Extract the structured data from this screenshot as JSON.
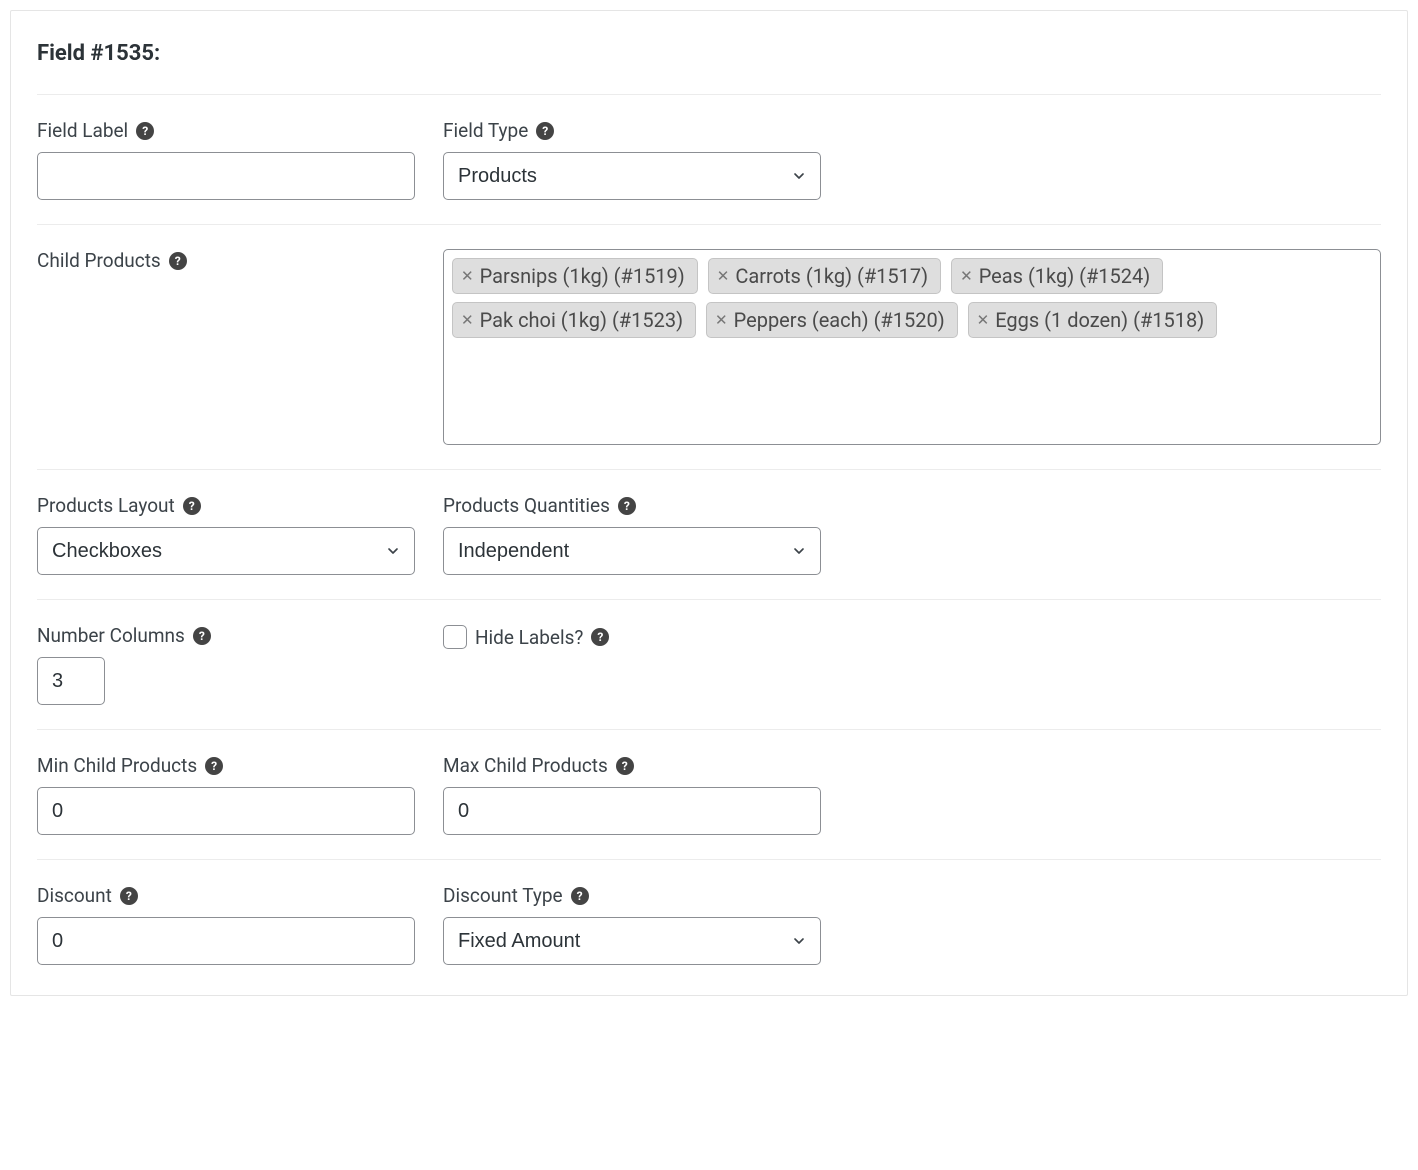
{
  "panel": {
    "title": "Field #1535:"
  },
  "fieldLabel": {
    "label": "Field Label",
    "value": ""
  },
  "fieldType": {
    "label": "Field Type",
    "value": "Products"
  },
  "childProducts": {
    "label": "Child Products",
    "items": [
      "Parsnips (1kg) (#1519)",
      "Carrots (1kg) (#1517)",
      "Peas (1kg) (#1524)",
      "Pak choi (1kg) (#1523)",
      "Peppers (each) (#1520)",
      "Eggs (1 dozen) (#1518)"
    ]
  },
  "productsLayout": {
    "label": "Products Layout",
    "value": "Checkboxes"
  },
  "productsQuantities": {
    "label": "Products Quantities",
    "value": "Independent"
  },
  "numberColumns": {
    "label": "Number Columns",
    "value": "3"
  },
  "hideLabels": {
    "label": "Hide Labels?",
    "checked": false
  },
  "minChildProducts": {
    "label": "Min Child Products",
    "value": "0"
  },
  "maxChildProducts": {
    "label": "Max Child Products",
    "value": "0"
  },
  "discount": {
    "label": "Discount",
    "value": "0"
  },
  "discountType": {
    "label": "Discount Type",
    "value": "Fixed Amount"
  }
}
